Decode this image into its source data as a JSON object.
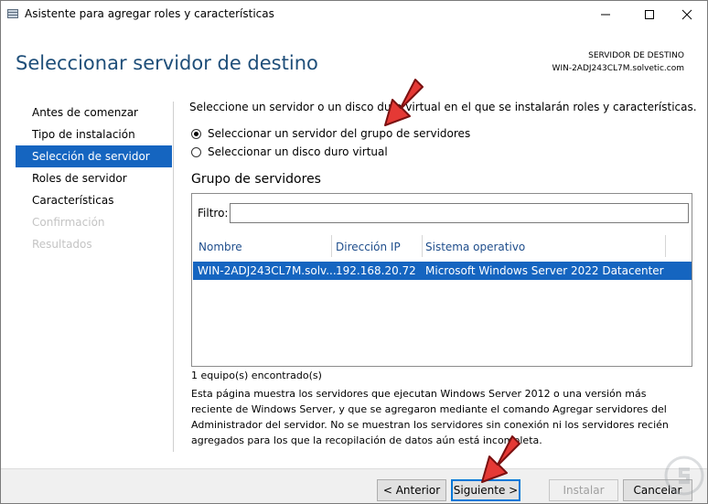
{
  "window": {
    "title": "Asistente para agregar roles y características"
  },
  "header": {
    "title": "Seleccionar servidor de destino",
    "dest_label": "SERVIDOR DE DESTINO",
    "dest_server": "WIN-2ADJ243CL7M.solvetic.com"
  },
  "sidebar": {
    "items": [
      {
        "label": "Antes de comenzar",
        "state": "normal"
      },
      {
        "label": "Tipo de instalación",
        "state": "normal"
      },
      {
        "label": "Selección de servidor",
        "state": "active"
      },
      {
        "label": "Roles de servidor",
        "state": "normal"
      },
      {
        "label": "Características",
        "state": "normal"
      },
      {
        "label": "Confirmación",
        "state": "disabled"
      },
      {
        "label": "Resultados",
        "state": "disabled"
      }
    ]
  },
  "main": {
    "intro": "Seleccione un servidor o un disco duro virtual en el que se instalarán roles y características.",
    "options": [
      {
        "label": "Seleccionar un servidor del grupo de servidores",
        "checked": true
      },
      {
        "label": "Seleccionar un disco duro virtual",
        "checked": false
      }
    ],
    "group_title": "Grupo de servidores",
    "filter_label": "Filtro:",
    "filter_value": "",
    "columns": [
      "Nombre",
      "Dirección IP",
      "Sistema operativo"
    ],
    "rows": [
      {
        "name": "WIN-2ADJ243CL7M.solv...",
        "ip": "192.168.20.72",
        "os": "Microsoft Windows Server 2022 Datacenter",
        "selected": true
      }
    ],
    "count": "1 equipo(s) encontrado(s)",
    "description": "Esta página muestra los servidores que ejecutan Windows Server 2012 o una versión más reciente de Windows Server, y que se agregaron mediante el comando Agregar servidores del Administrador del servidor. No se muestran los servidores sin conexión ni los servidores recién agregados para los que la recopilación de datos aún está incompleta."
  },
  "footer": {
    "back": "< Anterior",
    "next": "Siguiente >",
    "install": "Instalar",
    "cancel": "Cancelar"
  },
  "colors": {
    "accent": "#1565c0",
    "title_blue": "#1e4e79",
    "annotation_arrow": "#e53935"
  }
}
